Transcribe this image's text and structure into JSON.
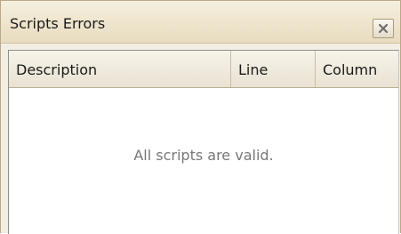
{
  "window": {
    "title": "Scripts Errors",
    "close_icon": "close-icon"
  },
  "grid": {
    "columns": [
      {
        "label": "Description"
      },
      {
        "label": "Line"
      },
      {
        "label": "Column"
      }
    ],
    "rows": [],
    "empty_message": "All scripts are valid."
  },
  "colors": {
    "panel_background": "#f3eee3",
    "titlebar_gradient_top": "#f6efdd",
    "titlebar_gradient_bottom": "#e8dcc0",
    "border": "#b9a988",
    "grid_background": "#ffffff",
    "empty_text": "#777777"
  }
}
